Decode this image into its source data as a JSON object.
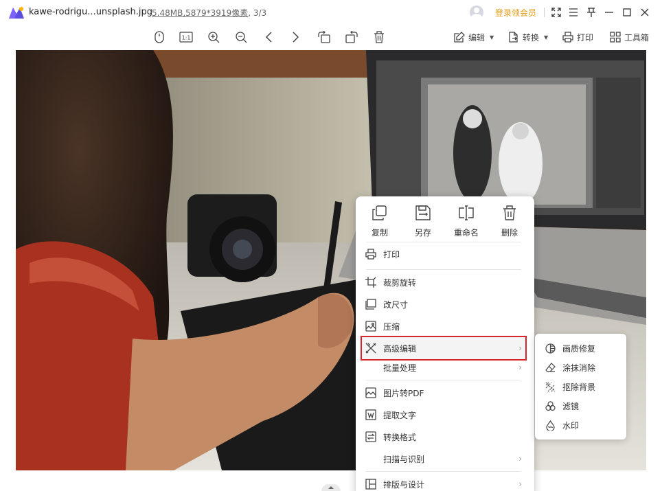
{
  "titlebar": {
    "filename": "kawe-rodrigu...unsplash.jpg",
    "filesize": "5.48MB",
    "dimensions": ",5879*3919像素",
    "position": ", 3/3",
    "vip_label": "登录领会员",
    "accent_color": "#e39a14"
  },
  "toolbar": {
    "edit_label": "编辑",
    "convert_label": "转换",
    "print_label": "打印",
    "toolbox_label": "工具箱"
  },
  "context_menu": {
    "quick_actions": [
      {
        "label": "复制",
        "icon": "copy-icon"
      },
      {
        "label": "另存",
        "icon": "save-as-icon"
      },
      {
        "label": "重命名",
        "icon": "rename-icon"
      },
      {
        "label": "删除",
        "icon": "trash-icon"
      }
    ],
    "items": [
      {
        "label": "打印",
        "icon": "printer-icon"
      },
      {
        "label": "裁剪旋转",
        "icon": "crop-icon"
      },
      {
        "label": "改尺寸",
        "icon": "resize-icon"
      },
      {
        "label": "压缩",
        "icon": "compress-icon"
      },
      {
        "label": "高级编辑",
        "icon": "advanced-edit-icon",
        "arrow": "›"
      },
      {
        "label": "批量处理",
        "arrow": "›"
      },
      {
        "label": "图片转PDF",
        "icon": "pdf-icon"
      },
      {
        "label": "提取文字",
        "icon": "ocr-icon"
      },
      {
        "label": "转换格式",
        "icon": "convert-format-icon"
      },
      {
        "label": "扫描与识别",
        "arrow": "›"
      },
      {
        "label": "排版与设计",
        "icon": "layout-icon",
        "arrow": "›"
      }
    ],
    "highlight_color": "#d9232b"
  },
  "submenu": {
    "items": [
      {
        "label": "画质修复",
        "icon": "quality-repair-icon"
      },
      {
        "label": "涂抹消除",
        "icon": "eraser-icon"
      },
      {
        "label": "抠除背景",
        "icon": "remove-background-icon"
      },
      {
        "label": "滤镜",
        "icon": "filter-icon"
      },
      {
        "label": "水印",
        "icon": "watermark-icon"
      }
    ]
  }
}
